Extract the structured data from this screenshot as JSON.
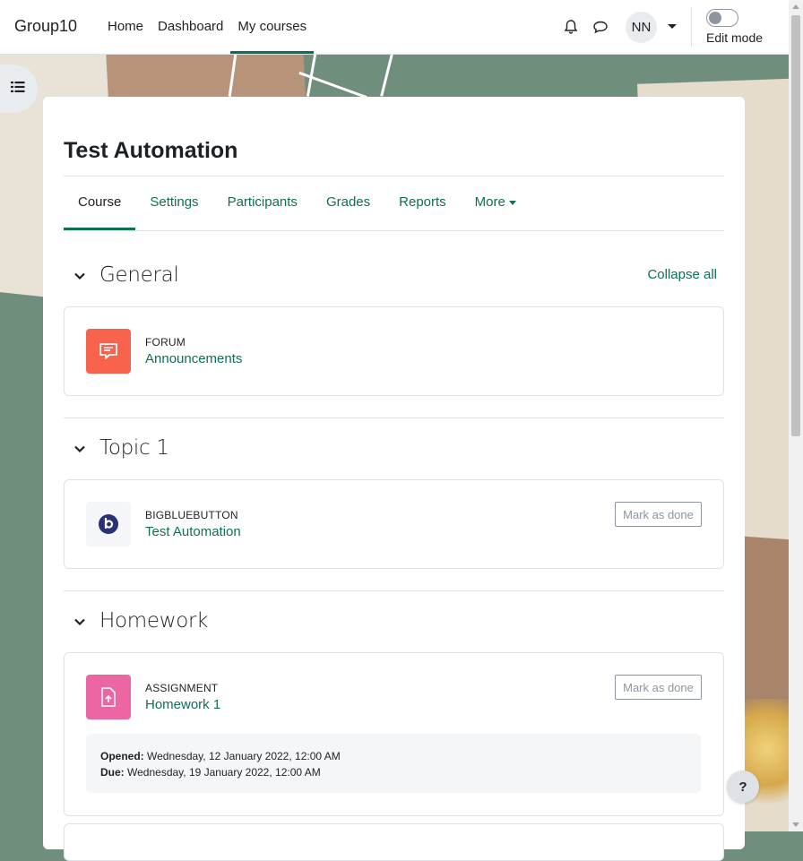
{
  "navbar": {
    "brand": "Group10",
    "links": [
      {
        "label": "Home"
      },
      {
        "label": "Dashboard"
      },
      {
        "label": "My courses"
      }
    ],
    "avatar_initials": "NN",
    "edit_mode_label": "Edit mode",
    "edit_mode_on": false
  },
  "course": {
    "title": "Test Automation",
    "tabs": [
      {
        "label": "Course",
        "active": true
      },
      {
        "label": "Settings"
      },
      {
        "label": "Participants"
      },
      {
        "label": "Grades"
      },
      {
        "label": "Reports"
      },
      {
        "label": "More"
      }
    ],
    "collapse_all": "Collapse all",
    "sections": [
      {
        "title": "General",
        "activity": {
          "type": "FORUM",
          "name": "Announcements",
          "icon": "forum-icon",
          "color": "#f7634d"
        }
      },
      {
        "title": "Topic 1",
        "activity": {
          "type": "BIGBLUEBUTTON",
          "name": "Test Automation",
          "icon": "bigbluebutton-icon",
          "mark_done": "Mark as done"
        }
      },
      {
        "title": "Homework",
        "activity": {
          "type": "ASSIGNMENT",
          "name": "Homework 1",
          "icon": "assignment-icon",
          "color": "#eb66a2",
          "mark_done": "Mark as done",
          "opened_label": "Opened:",
          "opened_value": "Wednesday, 12 January 2022, 12:00 AM",
          "due_label": "Due:",
          "due_value": "Wednesday, 19 January 2022, 12:00 AM"
        }
      }
    ]
  },
  "help_label": "?",
  "colors": {
    "accent": "#0f6e58",
    "forum": "#f7634d",
    "assignment": "#eb66a2"
  }
}
